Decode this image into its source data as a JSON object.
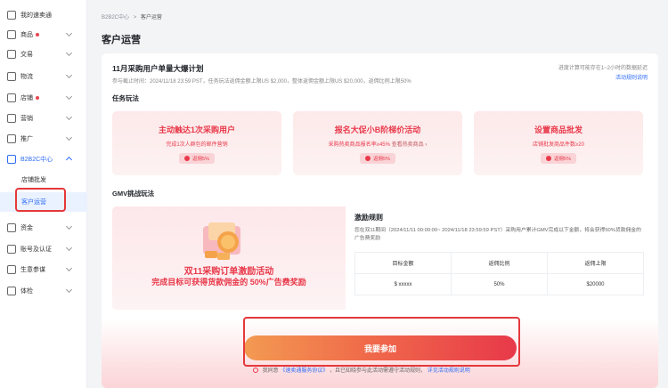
{
  "sidebar": {
    "items": [
      {
        "label": "我的速卖通",
        "icon": "home-icon",
        "dot": false,
        "chevron": false
      },
      {
        "label": "商品",
        "icon": "product-icon",
        "dot": true,
        "chevron": true
      },
      {
        "label": "交易",
        "icon": "trade-icon",
        "dot": false,
        "chevron": true
      },
      {
        "label": "物流",
        "icon": "truck-icon",
        "dot": false,
        "chevron": true
      },
      {
        "label": "店铺",
        "icon": "shop-icon",
        "dot": true,
        "chevron": true
      },
      {
        "label": "营销",
        "icon": "marketing-icon",
        "dot": false,
        "chevron": true
      },
      {
        "label": "推广",
        "icon": "promote-icon",
        "dot": false,
        "chevron": true
      },
      {
        "label": "B2B2C中心",
        "icon": "b2b2c-icon",
        "dot": false,
        "chevron": true
      },
      {
        "label": "资金",
        "icon": "funds-icon",
        "dot": false,
        "chevron": true
      },
      {
        "label": "账号及认证",
        "icon": "account-icon",
        "dot": false,
        "chevron": true
      },
      {
        "label": "生意参谋",
        "icon": "analytics-icon",
        "dot": false,
        "chevron": true
      },
      {
        "label": "体检",
        "icon": "checkup-icon",
        "dot": false,
        "chevron": true
      }
    ],
    "sub_items": [
      "店铺批发",
      "客户运营"
    ]
  },
  "breadcrumb": {
    "parent": "B2B2C中心",
    "sep": ">",
    "current": "客户运营"
  },
  "page_title": "客户运营",
  "plan": {
    "title": "11月采购用户单量大爆计划",
    "info": "参与截止时间：2024/11/18 23:59 PST，任务玩法返佣金额上限US $2,000，整体返佣金额上限US $20,000，返佣比例上限50%",
    "notice": "进度计算可能存在1~2小时的数据延迟",
    "rule_link": "活动规则说明"
  },
  "tasks_section_title": "任务玩法",
  "tasks": [
    {
      "title": "主动触达1次采购用户",
      "desc": "完成1次人群包的邮件营销",
      "desc_link": "",
      "reward": "返佣5%"
    },
    {
      "title": "报名大促小B阶梯价活动",
      "desc": "采购热卖商品报名率≥45%",
      "desc_link": "查看热卖商品 ›",
      "reward": "返佣5%"
    },
    {
      "title": "设置商品批发",
      "desc": "店铺批发商品件数≥20",
      "desc_link": "",
      "reward": "返佣5%"
    }
  ],
  "gmv_section_title": "GMV挑战玩法",
  "gmv": {
    "banner_line1": "双11采购订单激励活动",
    "banner_line2": "完成目标可获得货款佣金的 50%广告费奖励",
    "incentive_title": "激励规则",
    "incentive_desc": "您在双11期间（2024/11/11 00:00:00~ 2024/11/18 23:59:59 PST）采购用户累计GMV完成以下金额，将会获得50%货款佣金的广告费奖励",
    "table_headers": [
      "目标金额",
      "返佣比例",
      "返佣上限"
    ],
    "table_rows": [
      [
        "$ xxxxx",
        "50%",
        "$20000"
      ]
    ]
  },
  "join_button": "我要参加",
  "agreement": {
    "prefix": "我同意",
    "link1": "《速卖通服务协议》",
    "middle": "，且已知晓参与此活动需遵守活动规则，",
    "link2": "详见活动规则说明"
  },
  "colors": {
    "accent_red": "#e8394a",
    "brand_blue": "#2f6df6",
    "highlight_outline": "#e5383b"
  }
}
